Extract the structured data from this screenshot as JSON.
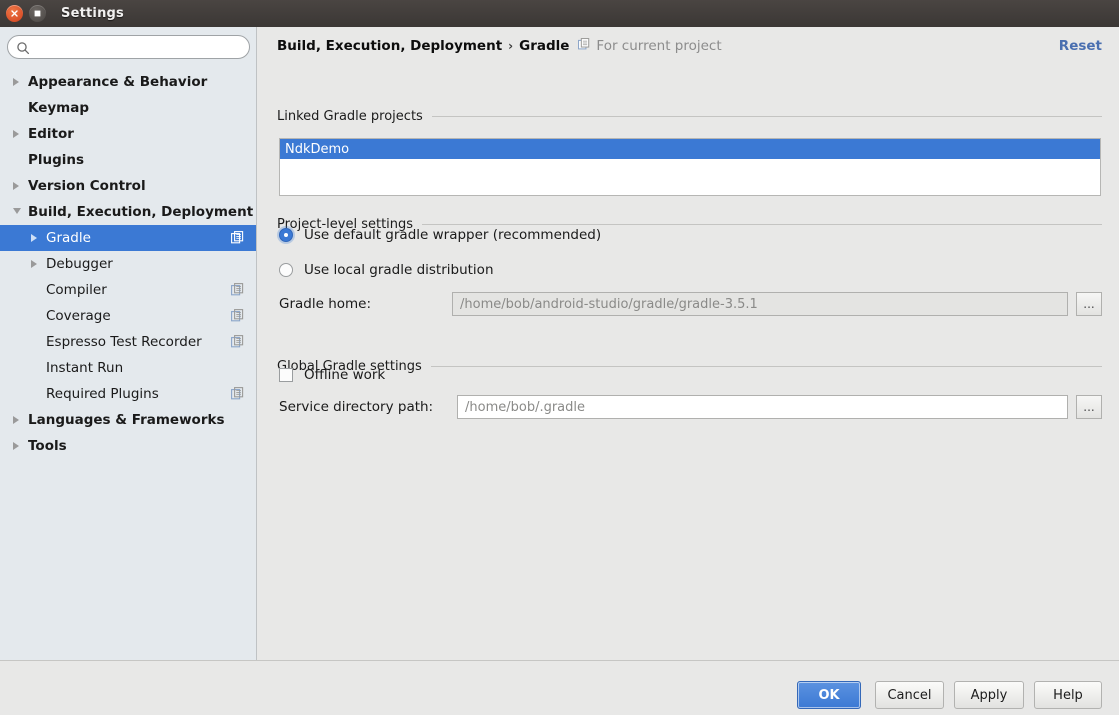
{
  "window": {
    "title": "Settings",
    "close_icon": "close-icon",
    "maximize_icon": "maximize-icon"
  },
  "sidebar": {
    "search": {
      "value": "",
      "placeholder": "",
      "icon": "search-icon"
    },
    "items": [
      {
        "label": "Appearance & Behavior",
        "level": 0,
        "arrow": "collapsed",
        "badge": false,
        "selected": false
      },
      {
        "label": "Keymap",
        "level": 0,
        "arrow": "none",
        "badge": false,
        "selected": false
      },
      {
        "label": "Editor",
        "level": 0,
        "arrow": "collapsed",
        "badge": false,
        "selected": false
      },
      {
        "label": "Plugins",
        "level": 0,
        "arrow": "none",
        "badge": false,
        "selected": false
      },
      {
        "label": "Version Control",
        "level": 0,
        "arrow": "collapsed",
        "badge": false,
        "selected": false
      },
      {
        "label": "Build, Execution, Deployment",
        "level": 0,
        "arrow": "expanded",
        "badge": false,
        "selected": false
      },
      {
        "label": "Gradle",
        "level": 1,
        "arrow": "collapsed",
        "badge": true,
        "selected": true
      },
      {
        "label": "Debugger",
        "level": 1,
        "arrow": "collapsed",
        "badge": false,
        "selected": false
      },
      {
        "label": "Compiler",
        "level": 1,
        "arrow": "none",
        "badge": true,
        "selected": false
      },
      {
        "label": "Coverage",
        "level": 1,
        "arrow": "none",
        "badge": true,
        "selected": false
      },
      {
        "label": "Espresso Test Recorder",
        "level": 1,
        "arrow": "none",
        "badge": true,
        "selected": false
      },
      {
        "label": "Instant Run",
        "level": 1,
        "arrow": "none",
        "badge": false,
        "selected": false
      },
      {
        "label": "Required Plugins",
        "level": 1,
        "arrow": "none",
        "badge": true,
        "selected": false
      },
      {
        "label": "Languages & Frameworks",
        "level": 0,
        "arrow": "collapsed",
        "badge": false,
        "selected": false
      },
      {
        "label": "Tools",
        "level": 0,
        "arrow": "collapsed",
        "badge": false,
        "selected": false
      }
    ]
  },
  "content": {
    "breadcrumb": {
      "root": "Build, Execution, Deployment",
      "separator": "›",
      "current": "Gradle",
      "scope_note": "For current project",
      "scope_icon": "project-scope-icon"
    },
    "reset_label": "Reset",
    "groups": {
      "linked_projects": "Linked Gradle projects",
      "project_level": "Project-level settings",
      "global_settings": "Global Gradle settings"
    },
    "linked_projects_list": [
      {
        "label": "NdkDemo",
        "selected": true
      }
    ],
    "radios": [
      {
        "label": "Use default gradle wrapper (recommended)",
        "checked": true
      },
      {
        "label": "Use local gradle distribution",
        "checked": false
      }
    ],
    "gradle_home": {
      "label": "Gradle home:",
      "value": "/home/bob/android-studio/gradle/gradle-3.5.1",
      "disabled": true,
      "browse_label": "..."
    },
    "offline_work": {
      "label": "Offline work",
      "checked": false
    },
    "service_directory": {
      "label": "Service directory path:",
      "value": "/home/bob/.gradle",
      "disabled": false,
      "browse_label": "..."
    }
  },
  "buttons": {
    "ok": "OK",
    "cancel": "Cancel",
    "apply": "Apply",
    "help": "Help"
  },
  "colors": {
    "accent": "#3b79d4",
    "link": "#4a6fb0",
    "sidebar_bg": "#e4e9ed",
    "content_bg": "#e8e8e7",
    "titlebar": "#3b3735"
  }
}
